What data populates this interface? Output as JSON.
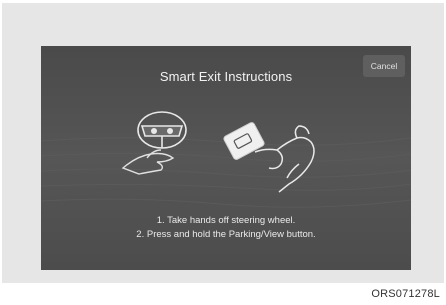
{
  "screen": {
    "title": "Smart Exit Instructions",
    "cancel_label": "Cancel",
    "instructions": [
      "1. Take hands off steering wheel.",
      "2. Press and hold the Parking/View button."
    ]
  },
  "caption": "ORS071278L",
  "icons": [
    "steering-wheel-icon",
    "hand-icon",
    "parking-view-button-icon"
  ],
  "colors": {
    "screen_bg": "#4f4f4f",
    "frame_bg": "#e6e6e6",
    "text": "#f2f2f2"
  }
}
